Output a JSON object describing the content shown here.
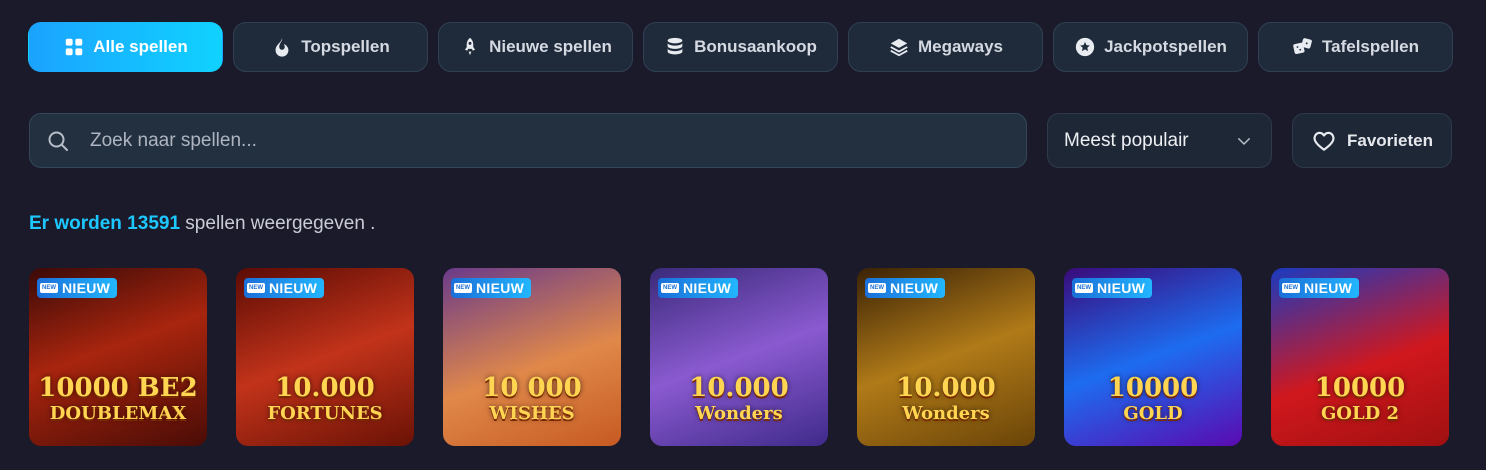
{
  "tabs": [
    {
      "label": "Alle spellen",
      "icon": "grid-icon",
      "active": true
    },
    {
      "label": "Topspellen",
      "icon": "flame-icon"
    },
    {
      "label": "Nieuwe spellen",
      "icon": "rocket-icon"
    },
    {
      "label": "Bonusaankoop",
      "icon": "coin-stack-icon"
    },
    {
      "label": "Megaways",
      "icon": "layers-icon"
    },
    {
      "label": "Jackpotspellen",
      "icon": "star-icon"
    },
    {
      "label": "Tafelspellen",
      "icon": "dice-icon"
    }
  ],
  "search": {
    "placeholder": "Zoek naar spellen..."
  },
  "sort": {
    "selected": "Meest populair"
  },
  "favorites": {
    "label": "Favorieten"
  },
  "count": {
    "highlight": "Er worden 13591",
    "rest": " spellen weergegeven ."
  },
  "badge": {
    "mini": "NEW",
    "label": "NIEUW"
  },
  "games": [
    {
      "title": "10000 BE2",
      "subtitle": "DOUBLEMAX",
      "bg": "linear-gradient(160deg,#3a0a08 0%,#a8250e 45%,#4a0c06 100%)"
    },
    {
      "title": "10.000",
      "subtitle": "FORTUNES",
      "bg": "linear-gradient(160deg,#5a0b05 0%,#c2331a 50%,#6a1206 100%)"
    },
    {
      "title": "10 000",
      "subtitle": "WISHES",
      "bg": "linear-gradient(160deg,#6a3a8a 0%,#e0884a 55%,#c65a22 100%)"
    },
    {
      "title": "10.000",
      "subtitle": "Wonders",
      "bg": "linear-gradient(160deg,#3a2a7a 0%,#8a5ad0 50%,#3f2a8a 100%)"
    },
    {
      "title": "10.000",
      "subtitle": "Wonders",
      "bg": "linear-gradient(160deg,#3a2206 0%,#b07a18 50%,#6a4408 100%)"
    },
    {
      "title": "10000",
      "subtitle": "GOLD",
      "bg": "linear-gradient(160deg,#3a0a7a 0%,#1d6cf0 50%,#5a0ab0 100%)"
    },
    {
      "title": "10000",
      "subtitle": "GOLD 2",
      "bg": "linear-gradient(160deg,#1a3ac0 0%,#d0181e 55%,#a01010 100%)"
    }
  ]
}
